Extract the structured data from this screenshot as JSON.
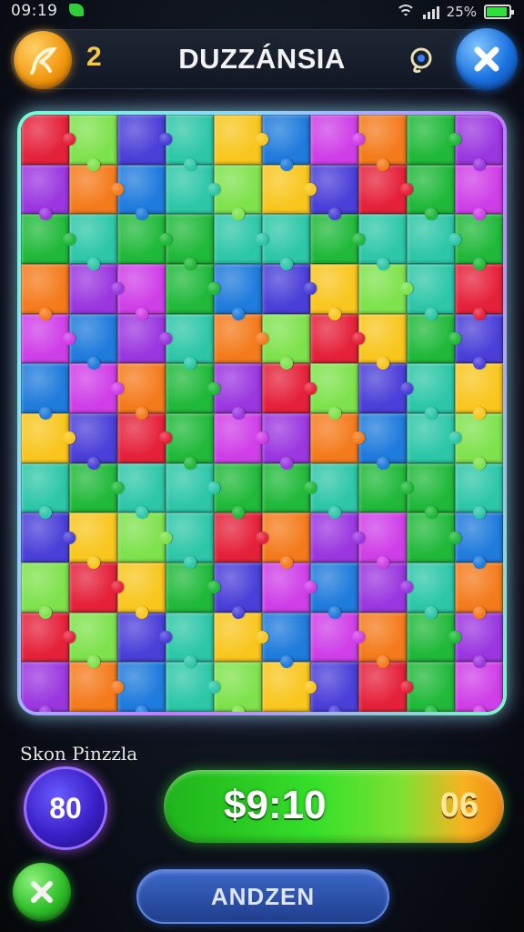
{
  "status_bar": {
    "time": "09:19",
    "battery_text": "25%",
    "battery_level": 0.9
  },
  "header": {
    "back_icon": "leaf-back-icon",
    "level": "2",
    "title": "DUZZÁNSIA",
    "hint_icon": "hint-icon",
    "close_icon": "close-x-icon"
  },
  "board": {
    "rows": 12,
    "columns": 10,
    "palette": [
      "#e5213a",
      "#f47b1c",
      "#f8c61d",
      "#7ee24c",
      "#20b93a",
      "#1f7bdc",
      "#4a3fd8",
      "#9b37e0",
      "#cf3fe8",
      "#2dc7a8"
    ]
  },
  "footer": {
    "game_name": "Skon Pinzzla",
    "score": "80",
    "timer": "$9:10",
    "timer_count": "06",
    "cancel_icon": "close-x-icon",
    "action_label": "ANDZEN"
  }
}
